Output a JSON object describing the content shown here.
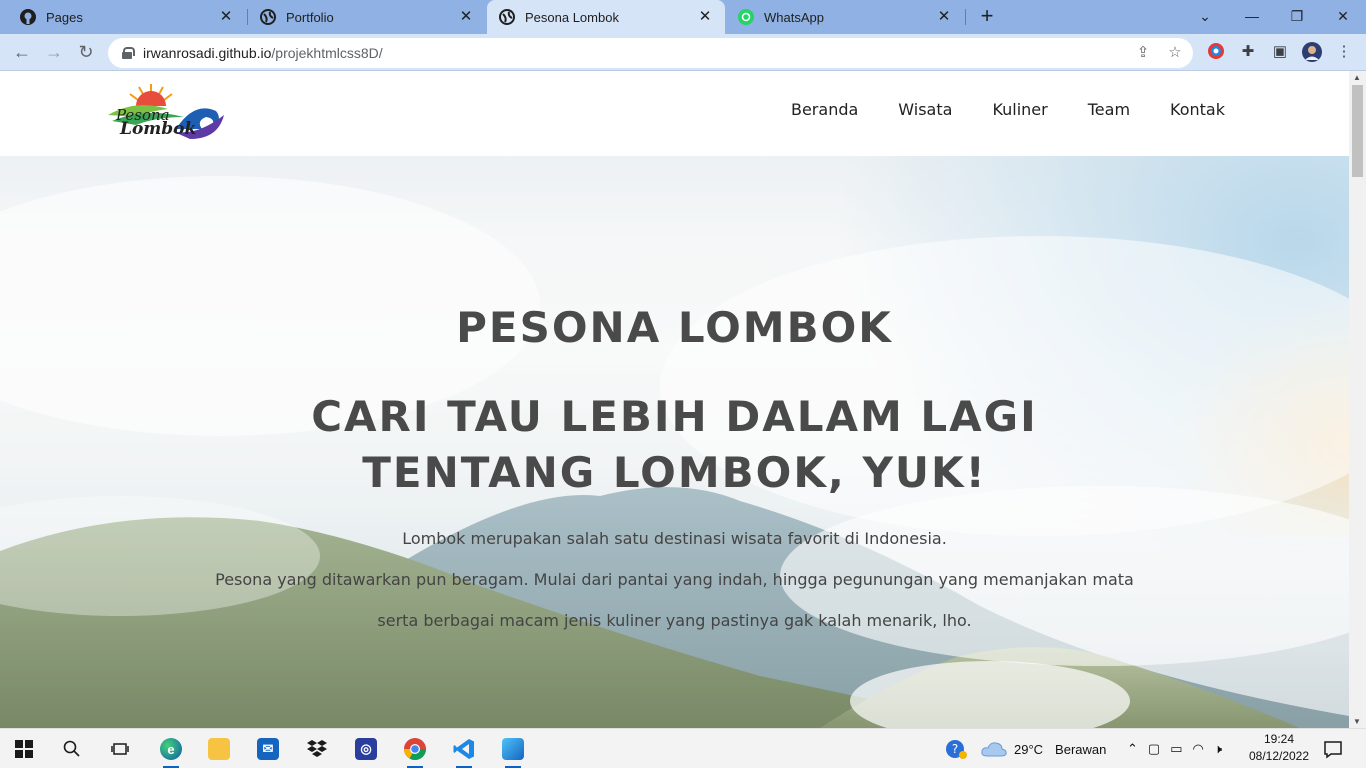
{
  "browser": {
    "tabs": [
      {
        "title": "Pages",
        "icon": "github-icon",
        "active": false
      },
      {
        "title": "Portfolio",
        "icon": "globe-icon",
        "active": false
      },
      {
        "title": "Pesona Lombok",
        "icon": "globe-icon",
        "active": true
      },
      {
        "title": "WhatsApp",
        "icon": "whatsapp-icon",
        "active": false
      }
    ],
    "url_host": "irwanrosadi.github.io",
    "url_path": "/projekhtmlcss8D/"
  },
  "site": {
    "logo_text_line1": "Pesona",
    "logo_text_line2": "Lombok",
    "nav": [
      "Beranda",
      "Wisata",
      "Kuliner",
      "Team",
      "Kontak"
    ],
    "hero_title": "PESONA LOMBOK",
    "hero_tagline": "CARI TAU LEBIH DALAM LAGI TENTANG LOMBOK, YUK!",
    "hero_description": [
      "Lombok merupakan salah satu destinasi wisata favorit di Indonesia.",
      "Pesona yang ditawarkan pun beragam. Mulai dari pantai yang indah, hingga pegunungan yang memanjakan mata",
      "serta berbagai macam jenis kuliner yang pastinya gak kalah menarik, lho."
    ]
  },
  "taskbar": {
    "weather_temp": "29°C",
    "weather_desc": "Berawan",
    "time": "19:24",
    "date": "08/12/2022"
  },
  "colors": {
    "tabstrip": "#8fb1e3",
    "toolbar": "#d6e4f7",
    "hero_text": "#4a4a4a"
  }
}
